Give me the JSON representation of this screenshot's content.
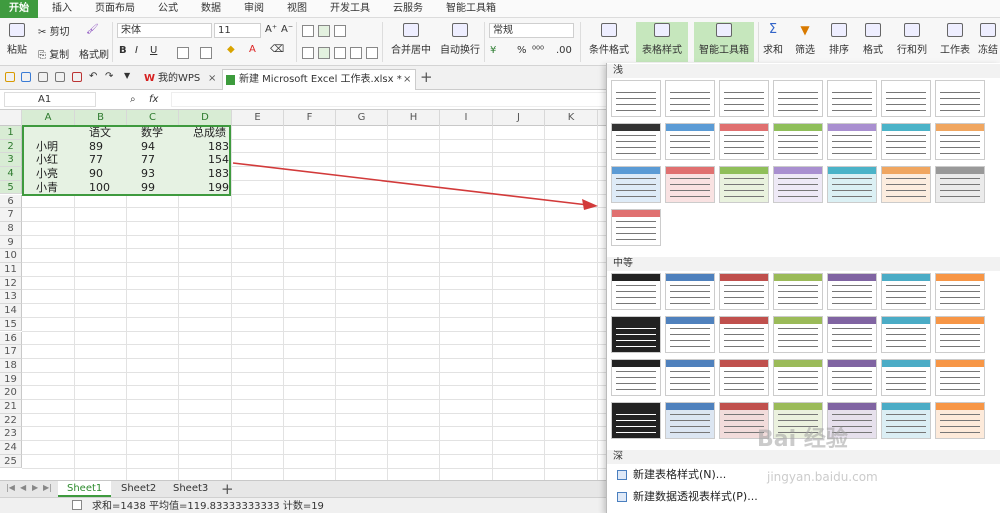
{
  "menubar": {
    "items": [
      "开始",
      "插入",
      "页面布局",
      "公式",
      "数据",
      "审阅",
      "视图",
      "开发工具",
      "云服务",
      "智能工具箱"
    ]
  },
  "ribbon": {
    "paste": "粘贴",
    "cut": "剪切",
    "copy": "复制",
    "format_painter": "格式刷",
    "font_name": "宋体",
    "font_size": "11",
    "number_format": "常规",
    "merge_center": "合并居中",
    "wrap_text": "自动换行",
    "conditional_format": "条件格式",
    "table_style": "表格样式",
    "smart_toolbox": "智能工具箱",
    "sum": "求和",
    "filter": "筛选",
    "sort": "排序",
    "format": "格式",
    "rowcol": "行和列",
    "worksheet": "工作表",
    "freeze": "冻结"
  },
  "tabs": {
    "wps": "我的WPS",
    "doc": "新建 Microsoft Excel 工作表.xlsx *",
    "close": "×",
    "add": "+"
  },
  "formula_bar": {
    "name_box": "A1",
    "fx": "fx",
    "value": ""
  },
  "columns": [
    "A",
    "B",
    "C",
    "D",
    "E",
    "F",
    "G",
    "H",
    "I",
    "J",
    "K"
  ],
  "rows": [
    "1",
    "2",
    "3",
    "4",
    "5",
    "6",
    "7",
    "8",
    "9",
    "10",
    "11",
    "12",
    "13",
    "14",
    "15",
    "16",
    "17",
    "18",
    "19",
    "20",
    "21",
    "22",
    "23",
    "24",
    "25"
  ],
  "table": {
    "header": [
      "",
      "语文",
      "数学",
      "总成绩"
    ],
    "rows": [
      [
        "小明",
        "89",
        "94",
        "183"
      ],
      [
        "小红",
        "77",
        "77",
        "154"
      ],
      [
        "小亮",
        "90",
        "93",
        "183"
      ],
      [
        "小青",
        "100",
        "99",
        "199"
      ]
    ]
  },
  "sheet_tabs": [
    "Sheet1",
    "Sheet2",
    "Sheet3"
  ],
  "sheet_tab_add": "+",
  "status_bar": {
    "text": "求和=1438 平均值=119.83333333333 计数=19"
  },
  "gallery": {
    "light_header": "浅",
    "medium_header": "中等",
    "dark_header": "深",
    "menu_new_table_style": "新建表格样式(N)...",
    "menu_new_pivot_style": "新建数据透视表样式(P)...",
    "light_colors": [
      "#999999",
      "#333333",
      "#5b9bd5",
      "#e07070",
      "#8fbf5a",
      "#a98fd0",
      "#4bb3c8",
      "#f0a660"
    ],
    "medium_colors": [
      "#222222",
      "#4f81bd",
      "#c0504d",
      "#9bbb59",
      "#8064a2",
      "#4bacc6",
      "#f79646"
    ]
  },
  "watermark": {
    "brand": "Bai 经验",
    "url": "jingyan.baidu.com"
  },
  "colors": {
    "accent": "#3e9a3e",
    "arrow": "#d23a3a"
  }
}
